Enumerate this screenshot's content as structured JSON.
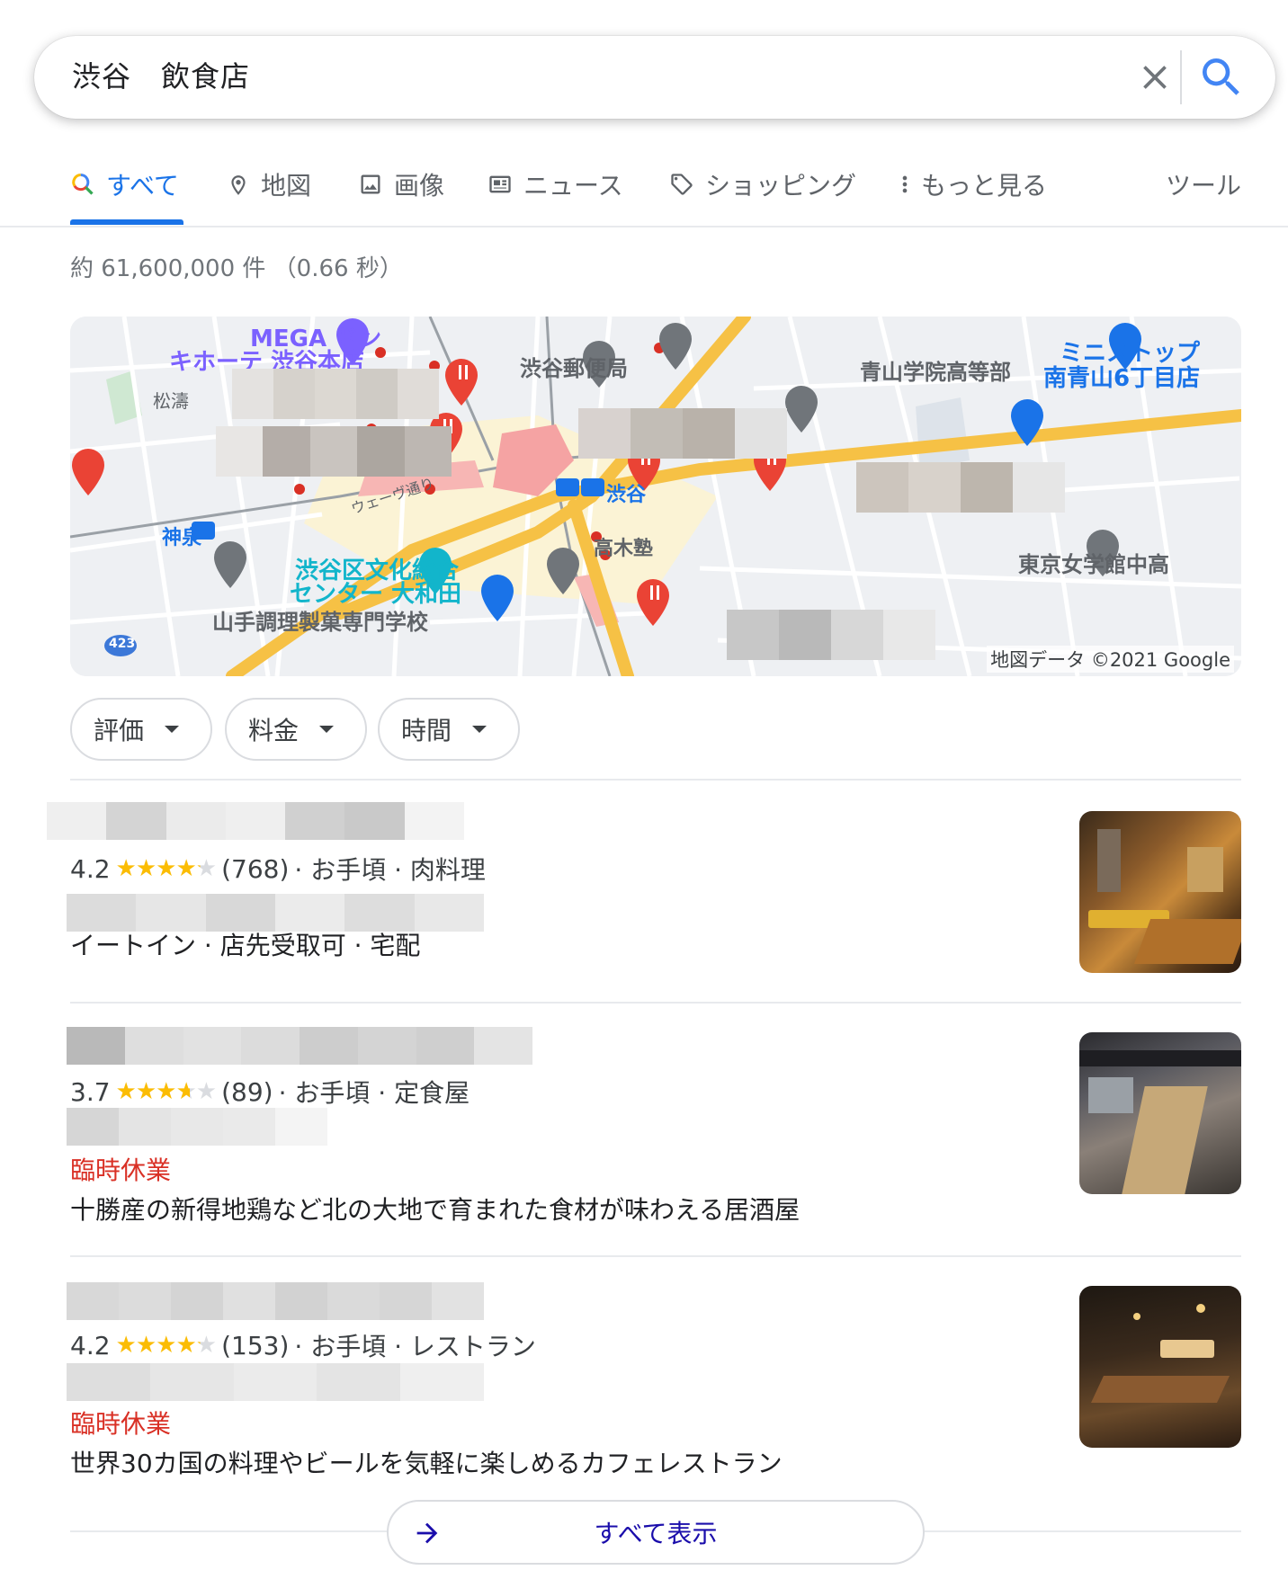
{
  "search": {
    "query": "渋谷　飲食店",
    "clear_icon": "close-icon",
    "search_icon": "search-icon",
    "accent": "#1a73e8"
  },
  "tabs": [
    {
      "label": "すべて",
      "icon": "search-icon",
      "active": true
    },
    {
      "label": "地図",
      "icon": "map-pin-icon"
    },
    {
      "label": "画像",
      "icon": "image-icon"
    },
    {
      "label": "ニュース",
      "icon": "news-icon"
    },
    {
      "label": "ショッピング",
      "icon": "tag-icon"
    },
    {
      "label": "もっと見る",
      "icon": "more-vert-icon"
    }
  ],
  "tools_label": "ツール",
  "result_stats": "約 61,600,000 件 （0.66 秒）",
  "map": {
    "labels": {
      "mega": "MEGA ドン",
      "kihote": "キホーテ 渋谷本店",
      "shoto": "松濤",
      "post": "渋谷郵便局",
      "aoyama": "青山学院高等部",
      "ministop": "ミニストップ",
      "minami": "南青山6丁目店",
      "station": "渋谷",
      "dogen": "ウェーヴ通り",
      "shinsen": "神泉",
      "bunka1": "渋谷区文化総合",
      "bunka2": "センター 大和田",
      "takagi": "高木塾",
      "tokyo": "東京女学館中高",
      "yamate": "山手調理製菓専門学校",
      "route": "423"
    },
    "attribution": "地図データ ©2021 Google"
  },
  "chips": [
    {
      "label": "評価"
    },
    {
      "label": "料金"
    },
    {
      "label": "時間"
    }
  ],
  "results": [
    {
      "rating": "4.2",
      "stars": 4.2,
      "reviews": "(768)",
      "meta": "· お手頃 · 肉料理",
      "status": "",
      "desc": "イートイン · 店先受取可 · 宅配"
    },
    {
      "rating": "3.7",
      "stars": 3.7,
      "reviews": "(89)",
      "meta": "· お手頃 · 定食屋",
      "status": "臨時休業",
      "desc": "十勝産の新得地鶏など北の大地で育まれた食材が味わえる居酒屋"
    },
    {
      "rating": "4.2",
      "stars": 4.2,
      "reviews": "(153)",
      "meta": "· お手頃 · レストラン",
      "status": "臨時休業",
      "desc": "世界30カ国の料理やビールを気軽に楽しめるカフェレストラン"
    }
  ],
  "show_all_label": "すべて表示",
  "colors": {
    "star": "#fbbc04",
    "closed": "#d93025",
    "link": "#1a0dab"
  }
}
